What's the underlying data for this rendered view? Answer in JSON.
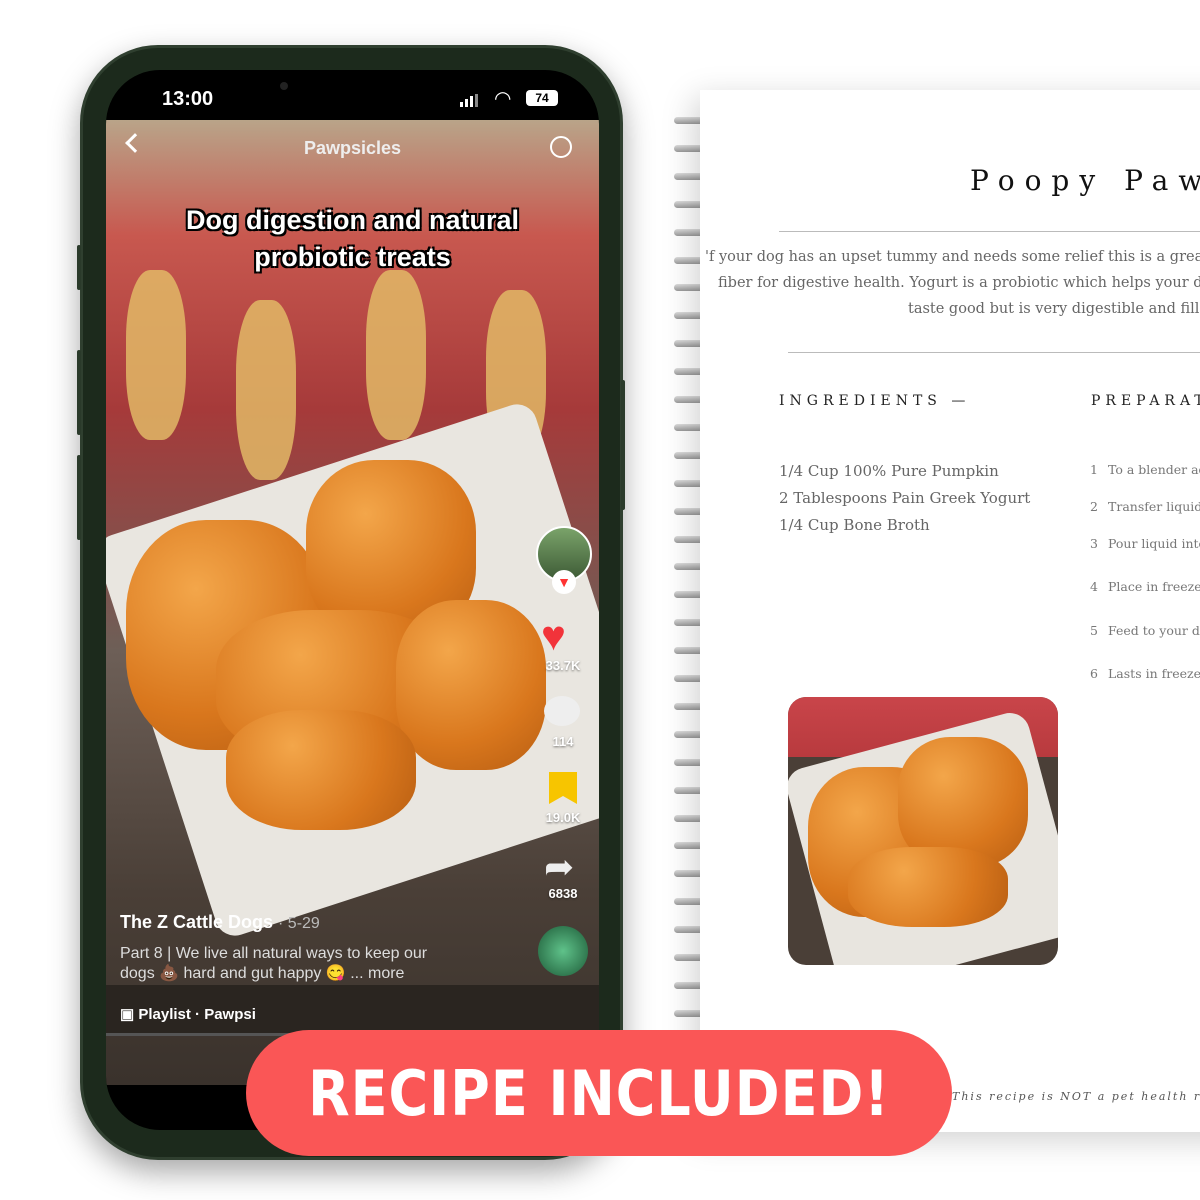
{
  "recipe": {
    "title": "Poopy Pawp",
    "intro": [
      "'f your dog has an upset tummy and needs some relief this is a great all n",
      "fiber for digestive health. Yogurt is a probiotic which helps your dogs gu",
      "taste good but is very digestible and filled w"
    ],
    "ingredients_heading": "INGREDIENTS —",
    "preparation_heading": "PREPARAT",
    "ingredients": [
      "1/4 Cup 100% Pure Pumpkin",
      "2 Tablespoons Pain Greek Yogurt",
      "1/4 Cup Bone Broth"
    ],
    "steps": [
      {
        "n": "1",
        "text": "To a blender add"
      },
      {
        "n": "2",
        "text": "Transfer liquid t"
      },
      {
        "n": "3",
        "text": "Pour liquid into"
      },
      {
        "n": "4",
        "text": "Place in freezer"
      },
      {
        "n": "5",
        "text": "Feed to your dog"
      },
      {
        "n": "6",
        "text": "Lasts in freezer f"
      }
    ],
    "disclaimer": "This recipe is NOT a pet health recomme"
  },
  "phone": {
    "time": "13:00",
    "battery": "74",
    "header_title": "Pawpsicles",
    "caption_line1": "Dog digestion and natural",
    "caption_line2": "probiotic treats",
    "likes": "33.7K",
    "comments": "114",
    "saves": "19.0K",
    "shares": "6838",
    "author": "The Z Cattle Dogs",
    "date": "· 5-29",
    "description_line1": "Part 8 | We live all natural ways to keep our",
    "description_line2": "dogs 💩 hard and gut happy 😋 ... more",
    "playlist": "Playlist · Pawpsi"
  },
  "banner": {
    "label": "RECIPE INCLUDED!",
    "color": "#fa5656"
  },
  "icons": [
    "back-arrow",
    "search",
    "signal",
    "wifi",
    "battery",
    "heart",
    "comment",
    "bookmark",
    "share"
  ]
}
